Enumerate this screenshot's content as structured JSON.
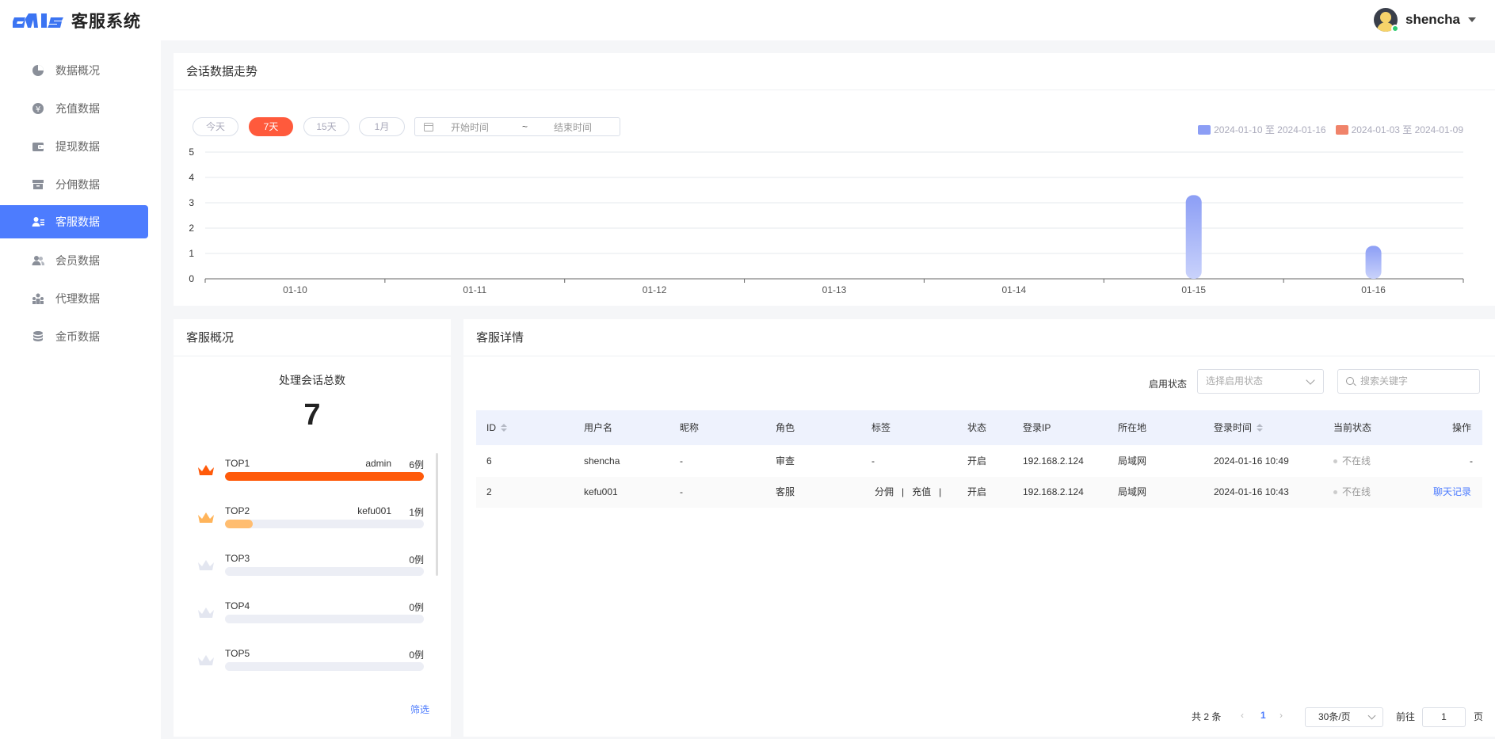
{
  "header": {
    "logo_mark": "cms",
    "app_title": "客服系统",
    "user_name": "shencha"
  },
  "sidebar": {
    "items": [
      {
        "label": "数据概况",
        "icon": "pie-chart-icon"
      },
      {
        "label": "充值数据",
        "icon": "coin-icon"
      },
      {
        "label": "提现数据",
        "icon": "wallet-icon"
      },
      {
        "label": "分佣数据",
        "icon": "archive-box-icon"
      },
      {
        "label": "客服数据",
        "icon": "user-list-icon",
        "active": true
      },
      {
        "label": "会员数据",
        "icon": "users-icon"
      },
      {
        "label": "代理数据",
        "icon": "agent-tree-icon"
      },
      {
        "label": "金币数据",
        "icon": "coins-stack-icon"
      }
    ],
    "accent": "#4d7cfe"
  },
  "trend": {
    "title": "会话数据走势",
    "ranges": [
      "今天",
      "7天",
      "15天",
      "1月"
    ],
    "active_range": "7天",
    "date_start_placeholder": "开始时间",
    "date_sep": "~",
    "date_end_placeholder": "结束时间",
    "legend": [
      {
        "label": "2024-01-10 至 2024-01-16",
        "color": "#8c9ef5"
      },
      {
        "label": "2024-01-03 至 2024-01-09",
        "color": "#f0836a"
      }
    ]
  },
  "chart_data": {
    "type": "bar",
    "categories": [
      "01-10",
      "01-11",
      "01-12",
      "01-13",
      "01-14",
      "01-15",
      "01-16"
    ],
    "series": [
      {
        "name": "2024-01-10 至 2024-01-16",
        "values": [
          0,
          0,
          0,
          0,
          0,
          3.3,
          1.3
        ],
        "color": "#8c9ef5"
      },
      {
        "name": "2024-01-03 至 2024-01-09",
        "values": [
          0,
          0,
          0,
          0,
          0,
          0,
          0
        ],
        "color": "#f0836a"
      }
    ],
    "yticks": [
      "0",
      "1",
      "2",
      "3",
      "4",
      "5"
    ],
    "ylim": [
      0,
      5
    ],
    "grid": true,
    "legend": "top-right"
  },
  "overview": {
    "title": "客服概况",
    "total_label": "处理会话总数",
    "total_value": "7",
    "tops": [
      {
        "rank": "TOP1",
        "name": "admin",
        "count": "6例",
        "fraction": 1.0,
        "color": "#ff5a0a",
        "crown": "#ff5a0a"
      },
      {
        "rank": "TOP2",
        "name": "kefu001",
        "count": "1例",
        "fraction": 0.14,
        "color": "#ffbd70",
        "crown": "#ffb45a"
      },
      {
        "rank": "TOP3",
        "name": "",
        "count": "0例",
        "fraction": 0,
        "color": "#eceef5",
        "crown": "#e3e6f0"
      },
      {
        "rank": "TOP4",
        "name": "",
        "count": "0例",
        "fraction": 0,
        "color": "#eceef5",
        "crown": "#e3e6f0"
      },
      {
        "rank": "TOP5",
        "name": "",
        "count": "0例",
        "fraction": 0,
        "color": "#eceef5",
        "crown": "#e3e6f0"
      }
    ],
    "filter_link": "筛选"
  },
  "detail": {
    "title": "客服详情",
    "status_filter_label": "启用状态",
    "status_filter_placeholder": "选择启用状态",
    "search_placeholder": "搜索关键字",
    "columns": [
      "ID",
      "用户名",
      "昵称",
      "角色",
      "标签",
      "状态",
      "登录IP",
      "所在地",
      "登录时间",
      "当前状态",
      "操作"
    ],
    "rows": [
      {
        "id": "6",
        "username": "shencha",
        "nickname": "-",
        "role": "审查",
        "tags": "-",
        "status": "开启",
        "ip": "192.168.2.124",
        "location": "局域网",
        "login_time": "2024-01-16 10:49",
        "online": "不在线",
        "action": "-"
      },
      {
        "id": "2",
        "username": "kefu001",
        "nickname": "-",
        "role": "客服",
        "tags": "分佣   |   充值   |",
        "status": "开启",
        "ip": "192.168.2.124",
        "location": "局域网",
        "login_time": "2024-01-16 10:43",
        "online": "不在线",
        "action": "聊天记录"
      }
    ],
    "pagination": {
      "total": "共 2 条",
      "current_page": "1",
      "page_size": "30条/页",
      "goto_label": "前往",
      "goto_value": "1",
      "page_unit": "页"
    }
  }
}
